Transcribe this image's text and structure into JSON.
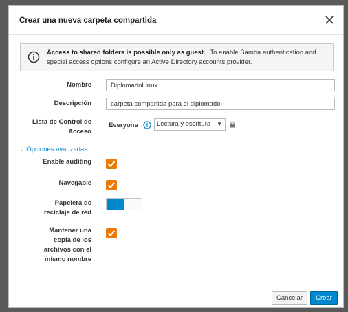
{
  "dialog": {
    "title": "Crear una nueva carpeta compartida",
    "close_icon": "close-icon"
  },
  "alert": {
    "icon": "info-icon",
    "bold_text": "Access to shared folders is possible only as guest.",
    "text": "To enable Samba authentication and special access options configure an Active Directory accounts provider."
  },
  "form": {
    "name_label": "Nombre",
    "name_value": "DiplomadoLinux",
    "description_label": "Descripción",
    "description_value": "carpeta compartida para el diplomado",
    "acl_label_line1": "Lista de Control de",
    "acl_label_line2": "Acceso",
    "acl_user": "Everyone",
    "acl_permission": "Lectura y escritura",
    "advanced_toggle": "Opciones avanzadas",
    "auditing_label": "Enable auditing",
    "auditing_checked": true,
    "browsable_label": "Navegable",
    "browsable_checked": true,
    "recycle_label_line1": "Papelera de",
    "recycle_label_line2": "reciclaje de red",
    "recycle_enabled": true,
    "keep_copy_label_line1": "Mantener una",
    "keep_copy_label_line2": "copia de los",
    "keep_copy_label_line3": "archivos con el",
    "keep_copy_label_line4": "mismo nombre",
    "keep_copy_checked": true
  },
  "buttons": {
    "cancel": "Cancelar",
    "create": "Crear"
  },
  "colors": {
    "accent": "#0088ce",
    "checkbox": "#ec7a08"
  }
}
